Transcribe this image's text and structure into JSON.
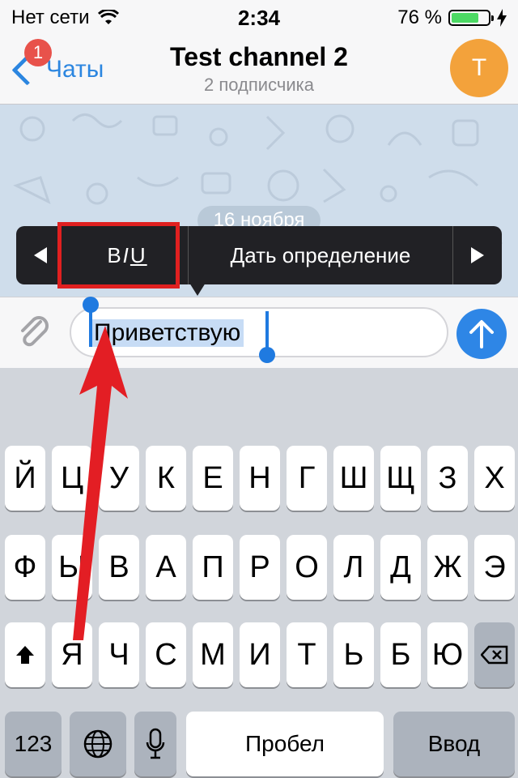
{
  "status_bar": {
    "carrier": "Нет сети",
    "time": "2:34",
    "battery_percent": "76 %",
    "battery_level": 0.76,
    "icons": [
      "wifi-icon",
      "battery-icon",
      "charging-icon"
    ]
  },
  "nav": {
    "back_label": "Чаты",
    "unread_badge": "1",
    "title": "Test channel 2",
    "subtitle": "2 подписчика",
    "avatar_letter": "T",
    "avatar_color": "#f3a23b"
  },
  "chat": {
    "date_label": "16 ноября"
  },
  "context_menu": {
    "format_bold": "B",
    "format_italic": "I",
    "format_underline": "U",
    "define_label": "Дать определение"
  },
  "input": {
    "value": "Приветствую"
  },
  "keyboard": {
    "row1": [
      "Й",
      "Ц",
      "У",
      "К",
      "Е",
      "Н",
      "Г",
      "Ш",
      "Щ",
      "З",
      "Х"
    ],
    "row2": [
      "Ф",
      "Ы",
      "В",
      "А",
      "П",
      "Р",
      "О",
      "Л",
      "Д",
      "Ж",
      "Э"
    ],
    "row3": [
      "Я",
      "Ч",
      "С",
      "М",
      "И",
      "Т",
      "Ь",
      "Б",
      "Ю"
    ],
    "numbers_label": "123",
    "space_label": "Пробел",
    "return_label": "Ввод"
  },
  "colors": {
    "accent": "#2c86e0",
    "annotation": "#e02020"
  }
}
